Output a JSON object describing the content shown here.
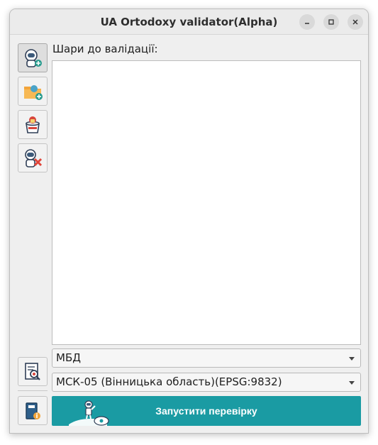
{
  "window": {
    "title": "UA Ortodoxy validator(Alpha)",
    "controls": [
      "minimize-icon",
      "maximize-icon",
      "close-icon"
    ]
  },
  "toolbar": {
    "buttons": [
      {
        "icon": "astronaut-add-icon"
      },
      {
        "icon": "folder-add-icon"
      },
      {
        "icon": "database-lock-icon"
      },
      {
        "icon": "astronaut-remove-icon"
      }
    ]
  },
  "layers": {
    "label": "Шари до валідації:",
    "items": []
  },
  "structure_select": {
    "selected": "МБД"
  },
  "crs_select": {
    "selected": "МСК-05 (Вінницька область)(EPSG:9832)"
  },
  "bottom_tools": [
    {
      "icon": "document-search-icon"
    },
    {
      "icon": "book-info-icon"
    }
  ],
  "run_button": {
    "label": "Запустити перевірку",
    "icon": "astronaut-rocket-icon"
  },
  "colors": {
    "accent": "#1a9ba3",
    "window_bg": "#efefef",
    "title_text": "#2e2e2e"
  }
}
